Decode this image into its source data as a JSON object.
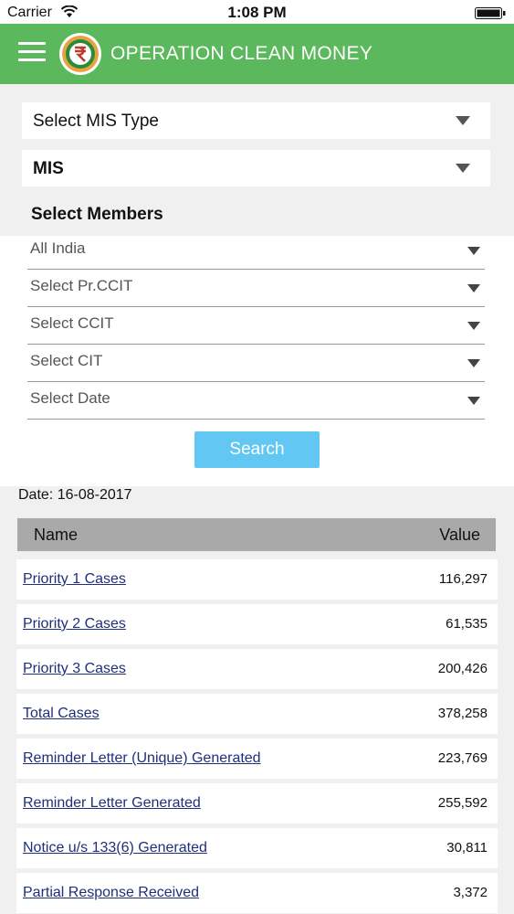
{
  "status_bar": {
    "carrier": "Carrier",
    "time": "1:08 PM"
  },
  "header": {
    "title": "OPERATION CLEAN MONEY",
    "color": "#5cb85c"
  },
  "filters": {
    "mis_type_label": "Select MIS Type",
    "mis_label": "MIS",
    "members_title": "Select Members",
    "members": [
      {
        "label": "All India"
      },
      {
        "label": "Select Pr.CCIT"
      },
      {
        "label": "Select CCIT"
      },
      {
        "label": "Select CIT"
      },
      {
        "label": "Select Date"
      }
    ],
    "search_label": "Search",
    "search_color": "#62c8f3"
  },
  "report": {
    "date_text": "Date: 16-08-2017",
    "columns": {
      "name": "Name",
      "value": "Value"
    },
    "rows": [
      {
        "name": "Priority 1 Cases",
        "value": "116,297"
      },
      {
        "name": "Priority 2 Cases",
        "value": "61,535"
      },
      {
        "name": "Priority 3 Cases",
        "value": "200,426"
      },
      {
        "name": "Total Cases",
        "value": "378,258"
      },
      {
        "name": "Reminder Letter (Unique) Generated",
        "value": "223,769"
      },
      {
        "name": "Reminder Letter Generated",
        "value": "255,592"
      },
      {
        "name": "Notice u/s 133(6) Generated",
        "value": "30,811"
      },
      {
        "name": "Partial Response Received",
        "value": "3,372"
      }
    ]
  }
}
